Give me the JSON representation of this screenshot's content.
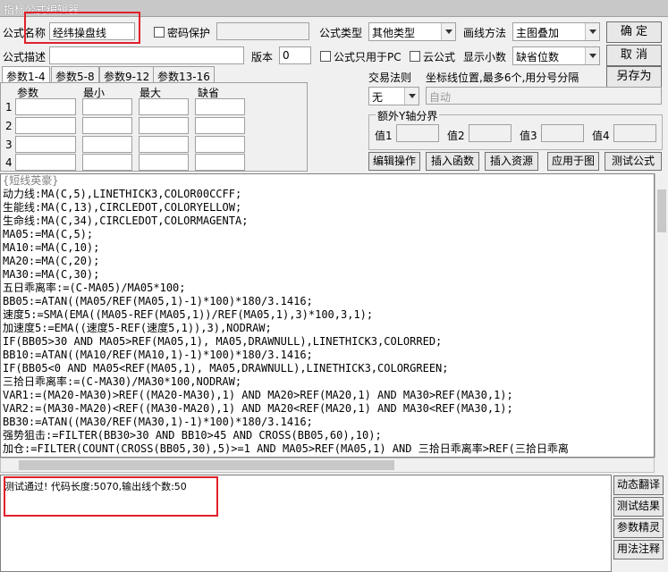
{
  "window": {
    "title": "指标公式编辑器"
  },
  "form": {
    "name_label": "公式名称",
    "name_value": "经纬操盘线",
    "password_label": "密码保护",
    "desc_label": "公式描述",
    "version_label": "版本",
    "version_value": "0",
    "type_label": "公式类型",
    "type_value": "其他类型",
    "draw_label": "画线方法",
    "draw_value": "主图叠加",
    "pc_only_label": "公式只用于PC",
    "cloud_label": "云公式",
    "decimals_label": "显示小数",
    "decimals_value": "缺省位数",
    "trade_rule_label": "交易法则",
    "trade_rule_value": "无",
    "coord_label": "坐标线位置,最多6个,用分号分隔",
    "coord_placeholder": "自动",
    "extra_y_label": "额外Y轴分界",
    "val1": "值1",
    "val2": "值2",
    "val3": "值3",
    "val4": "值4"
  },
  "buttons": {
    "ok": "确 定",
    "cancel": "取 消",
    "save_as": "另存为",
    "edit_ops": "编辑操作",
    "insert_func": "插入函数",
    "insert_res": "插入资源",
    "apply_chart": "应用于图",
    "test_formula": "测试公式",
    "dyn_translate": "动态翻译",
    "test_result": "测试结果",
    "param_tune": "参数精灵",
    "usage_note": "用法注释"
  },
  "tabs": [
    "参数1-4",
    "参数5-8",
    "参数9-12",
    "参数13-16"
  ],
  "param_headers": [
    "参数",
    "最小",
    "最大",
    "缺省"
  ],
  "param_rows": [
    "1",
    "2",
    "3",
    "4"
  ],
  "code": [
    "{短线英豪}",
    "动力线:MA(C,5),LINETHICK3,COLOR00CCFF;",
    "生能线:MA(C,13),CIRCLEDOT,COLORYELLOW;",
    "生命线:MA(C,34),CIRCLEDOT,COLORMAGENTA;",
    "MA05:=MA(C,5);",
    "MA10:=MA(C,10);",
    "MA20:=MA(C,20);",
    "MA30:=MA(C,30);",
    "五日乖离率:=(C-MA05)/MA05*100;",
    "BB05:=ATAN((MA05/REF(MA05,1)-1)*100)*180/3.1416;",
    "速度5:=SMA(EMA((MA05-REF(MA05,1))/REF(MA05,1),3)*100,3,1);",
    "加速度5:=EMA((速度5-REF(速度5,1)),3),NODRAW;",
    "IF(BB05>30 AND MA05>REF(MA05,1), MA05,DRAWNULL),LINETHICK3,COLORRED;",
    "BB10:=ATAN((MA10/REF(MA10,1)-1)*100)*180/3.1416;",
    "IF(BB05<0 AND MA05<REF(MA05,1), MA05,DRAWNULL),LINETHICK3,COLORGREEN;",
    "三拾日乖离率:=(C-MA30)/MA30*100,NODRAW;",
    "VAR1:=(MA20-MA30)>REF((MA20-MA30),1) AND MA20>REF(MA20,1) AND MA30>REF(MA30,1);",
    "VAR2:=(MA30-MA20)<REF((MA30-MA20),1) AND MA20<REF(MA20,1) AND MA30<REF(MA30,1);",
    "BB30:=ATAN((MA30/REF(MA30,1)-1)*100)*180/3.1416;",
    "强势狙击:=FILTER(BB30>30 AND BB10>45 AND CROSS(BB05,60),10);",
    "加仓:=FILTER(COUNT(CROSS(BB05,30),5)>=1 AND MA05>REF(MA05,1) AND 三拾日乖离率>REF(三拾日乖离"
  ],
  "output": {
    "message": "测试通过! 代码长度:5070,输出线个数:50"
  },
  "colors": {
    "highlight_box": "#e0202a"
  }
}
